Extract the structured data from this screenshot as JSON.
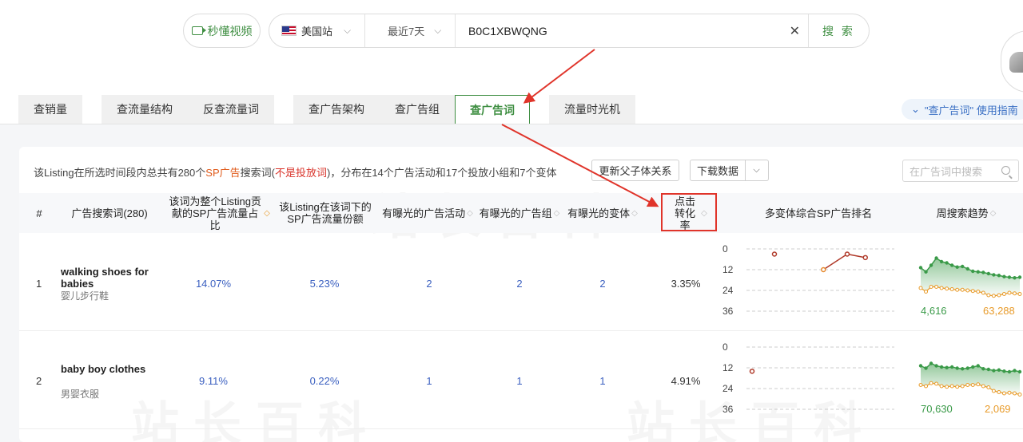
{
  "topbar": {
    "video_label": "秒懂视频",
    "site_label": "美国站",
    "date_label": "最近7天",
    "query_value": "B0C1XBWQNG",
    "search_label": "搜 索"
  },
  "tabs": [
    {
      "label": "查销量"
    },
    {
      "label": "查流量结构"
    },
    {
      "label": "反查流量词"
    },
    {
      "label": "查广告架构"
    },
    {
      "label": "查广告组"
    },
    {
      "label": "查广告词"
    },
    {
      "label": "流量时光机"
    }
  ],
  "guide_label": "\"查广告词\" 使用指南",
  "summary": {
    "part1": "该Listing在所选时间段内总共有280个",
    "sp": "SP广告",
    "part2": "搜索词(",
    "red": "不是投放词",
    "part3": ")，分布在14个广告活动和17个投放小组和7个变体"
  },
  "buttons": {
    "parent_child": "更新父子体关系",
    "download": "下载数据",
    "search_placeholder": "在广告词中搜索"
  },
  "columns": {
    "index": "#",
    "keyword": "广告搜索词(280)",
    "traffic_share": "该词为整个Listing贡献的SP广告流量占比",
    "listing_share": "该Listing在该词下的SP广告流量份额",
    "campaigns": "有曝光的广告活动",
    "adgroups": "有曝光的广告组",
    "variants": "有曝光的变体",
    "cvr": "点击转化率",
    "rank": "多变体综合SP广告排名",
    "trend": "周搜索趋势"
  },
  "rows": [
    {
      "index": "1",
      "keyword": "walking shoes for babies",
      "keyword_cn": "婴儿步行鞋",
      "traffic_share": "14.07%",
      "listing_share": "5.23%",
      "campaigns": "2",
      "adgroups": "2",
      "variants": "2",
      "cvr": "3.35%",
      "rank_ticks": [
        "0",
        "12",
        "24",
        "36"
      ],
      "rank_points": [
        [
          0.2,
          3
        ],
        [
          0.55,
          12
        ],
        [
          0.72,
          3
        ],
        [
          0.85,
          5
        ]
      ],
      "trend_left": "4,616",
      "trend_right": "63,288",
      "trend_green": [
        0.62,
        0.55,
        0.66,
        0.78,
        0.72,
        0.7,
        0.66,
        0.63,
        0.64,
        0.6,
        0.56,
        0.55,
        0.54,
        0.52,
        0.5,
        0.49,
        0.47,
        0.46,
        0.45,
        0.46
      ],
      "trend_orange": [
        0.28,
        0.22,
        0.3,
        0.3,
        0.28,
        0.27,
        0.26,
        0.25,
        0.25,
        0.24,
        0.23,
        0.22,
        0.2,
        0.16,
        0.15,
        0.16,
        0.18,
        0.2,
        0.19,
        0.18
      ]
    },
    {
      "index": "2",
      "keyword": "baby boy clothes",
      "keyword_cn": "男婴衣服",
      "traffic_share": "9.11%",
      "listing_share": "0.22%",
      "campaigns": "1",
      "adgroups": "1",
      "variants": "1",
      "cvr": "4.91%",
      "rank_ticks": [
        "0",
        "12",
        "24",
        "36"
      ],
      "rank_points": [
        [
          0.04,
          14
        ]
      ],
      "trend_left": "70,630",
      "trend_right": "2,069",
      "trend_green": [
        0.62,
        0.58,
        0.66,
        0.62,
        0.6,
        0.59,
        0.6,
        0.58,
        0.57,
        0.58,
        0.6,
        0.62,
        0.57,
        0.56,
        0.54,
        0.55,
        0.53,
        0.52,
        0.54,
        0.52
      ],
      "trend_orange": [
        0.3,
        0.28,
        0.33,
        0.32,
        0.28,
        0.27,
        0.28,
        0.27,
        0.28,
        0.3,
        0.3,
        0.31,
        0.28,
        0.26,
        0.2,
        0.18,
        0.16,
        0.17,
        0.16,
        0.14
      ]
    }
  ],
  "colors": {
    "brand_green": "#3e8e41",
    "link_blue": "#3a5fc0",
    "highlight_red": "#e0342a",
    "trend_green": "#3a9a48",
    "trend_orange": "#e89b2a",
    "rank_point": "#b03a2a"
  }
}
